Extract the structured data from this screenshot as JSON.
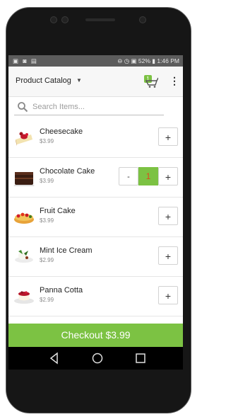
{
  "status_bar": {
    "left_icons": "▣ ◙ ▤",
    "right_text": "⊖ ◷ ▣ 52% ▮ 1:46 PM"
  },
  "app_bar": {
    "title": "Product Catalog",
    "cart_badge": "1"
  },
  "search": {
    "placeholder": "Search Items..."
  },
  "products": [
    {
      "name": "Cheesecake",
      "price": "$3.99",
      "icon": "cheesecake-icon",
      "quantity": ""
    },
    {
      "name": "Chocolate Cake",
      "price": "$3.99",
      "icon": "chocolate-cake-icon",
      "quantity": "1"
    },
    {
      "name": "Fruit Cake",
      "price": "$3.99",
      "icon": "fruit-cake-icon",
      "quantity": ""
    },
    {
      "name": "Mint Ice Cream",
      "price": "$2.99",
      "icon": "mint-ice-cream-icon",
      "quantity": ""
    },
    {
      "name": "Panna Cotta",
      "price": "$2.99",
      "icon": "panna-cotta-icon",
      "quantity": ""
    }
  ],
  "controls": {
    "plus": "+",
    "minus": "-"
  },
  "checkout": {
    "label": "Checkout $3.99"
  },
  "colors": {
    "accent_green": "#7cc243",
    "quantity_text": "#e2461f",
    "status_bar": "#5c5c5c"
  }
}
